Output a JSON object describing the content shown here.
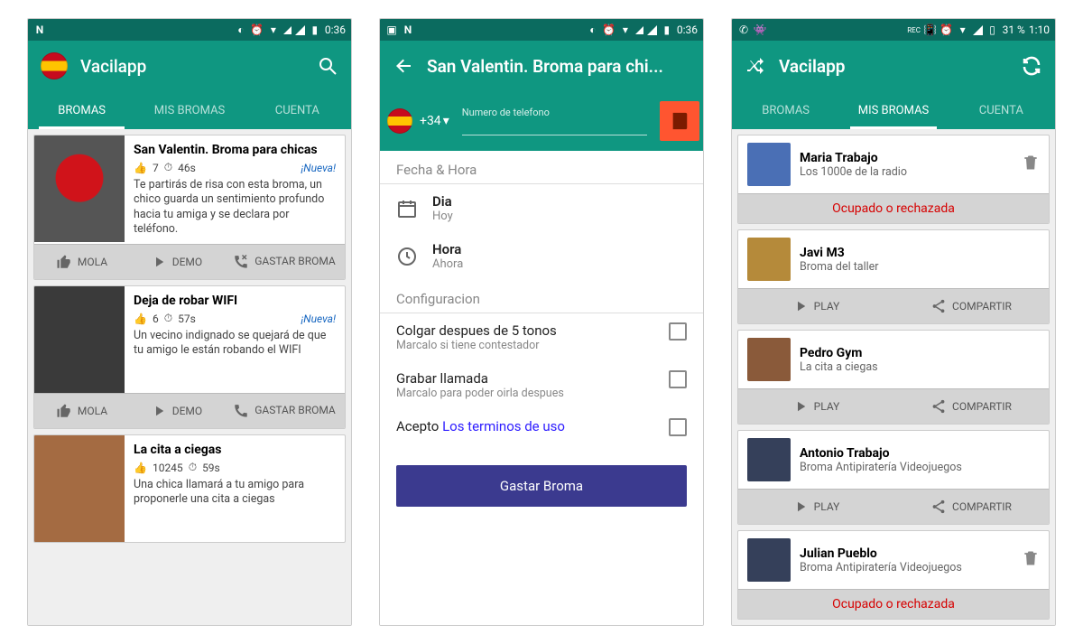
{
  "status1": {
    "time": "0:36"
  },
  "status3": {
    "battery": "31 %",
    "time": "1:10"
  },
  "s1": {
    "app_title": "Vacilapp",
    "tabs": [
      "BROMAS",
      "MIS BROMAS",
      "CUENTA"
    ],
    "cards": [
      {
        "title": "San Valentin. Broma para chicas",
        "likes": "7",
        "dur": "46s",
        "nueva": "¡Nueva!",
        "desc": "Te partirás de risa con esta broma, un chico guarda un sentimiento profundo hacia tu amiga y se declara por teléfono."
      },
      {
        "title": "Deja de robar WIFI",
        "likes": "6",
        "dur": "57s",
        "nueva": "¡Nueva!",
        "desc": "Un vecino indignado se quejará de que tu amigo le están robando el WIFI"
      },
      {
        "title": "La cita a ciegas",
        "likes": "10245",
        "dur": "59s",
        "desc": "Una chica llamará a tu amigo para proponerle una cita a ciegas"
      }
    ],
    "actions": {
      "mola": "MOLA",
      "demo": "DEMO",
      "gastar": "GASTAR BROMA"
    }
  },
  "s2": {
    "title": "San Valentin. Broma para chi...",
    "prefix": "+34",
    "phone_label": "Numero de telefono",
    "section1": "Fecha & Hora",
    "day_label": "Dia",
    "day_value": "Hoy",
    "time_label": "Hora",
    "time_value": "Ahora",
    "section2": "Configuracion",
    "cfg1_t": "Colgar despues de 5 tonos",
    "cfg1_s": "Marcalo si tiene contestador",
    "cfg2_t": "Grabar llamada",
    "cfg2_s": "Marcalo para poder oirla despues",
    "cfg3_pre": "Acepto ",
    "cfg3_link": "Los terminos de uso",
    "primary": "Gastar Broma"
  },
  "s3": {
    "app_title": "Vacilapp",
    "tabs": [
      "BROMAS",
      "MIS BROMAS",
      "CUENTA"
    ],
    "status_busy": "Ocupado o rechazada",
    "play": "PLAY",
    "share": "COMPARTIR",
    "items": [
      {
        "name": "Maria Trabajo",
        "sub": "Los 1000e de la radio",
        "busy": true,
        "trash": true
      },
      {
        "name": "Javi M3",
        "sub": "Broma del taller",
        "busy": false
      },
      {
        "name": "Pedro Gym",
        "sub": "La cita a ciegas",
        "busy": false
      },
      {
        "name": "Antonio Trabajo",
        "sub": "Broma Antipiratería Videojuegos",
        "busy": false
      },
      {
        "name": "Julian Pueblo",
        "sub": "Broma Antipiratería Videojuegos",
        "busy": true,
        "trash": true
      }
    ]
  }
}
